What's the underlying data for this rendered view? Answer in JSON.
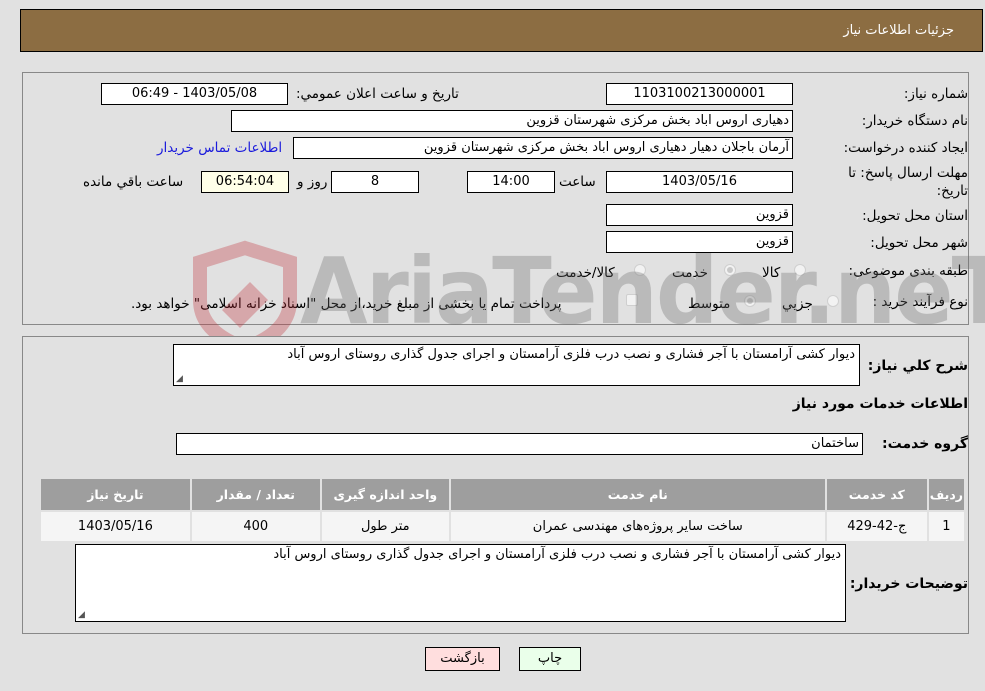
{
  "header": {
    "title": "جزئیات اطلاعات نیاز"
  },
  "fields": {
    "need_number": {
      "label": "شماره نیاز:",
      "value": "1103100213000001"
    },
    "announce_datetime": {
      "label": "تاریخ و ساعت اعلان عمومي:",
      "value": "1403/05/08 - 06:49"
    },
    "buyer_org": {
      "label": "نام دستگاه خریدار:",
      "value": "دهیاری اروس اباد بخش مرکزی شهرستان قزوین"
    },
    "requester": {
      "label": "ایجاد کننده درخواست:",
      "value": "آرمان باجلان دهیار دهیاری اروس اباد بخش مرکزی شهرستان قزوین"
    },
    "buyer_contact_link": "اطلاعات تماس خریدار",
    "deadline": {
      "label_line1": "مهلت ارسال پاسخ: تا",
      "label_line2": "تاریخ:",
      "date": "1403/05/16",
      "time_label": "ساعت",
      "time": "14:00",
      "days": "8",
      "days_label": "روز و",
      "remaining": "06:54:04",
      "remaining_label": "ساعت باقي مانده"
    },
    "delivery_province": {
      "label": "استان محل تحویل:",
      "value": "قزوین"
    },
    "delivery_city": {
      "label": "شهر محل تحویل:",
      "value": "قزوین"
    },
    "category": {
      "label": "طبقه بندی موضوعی:",
      "options": [
        "کالا",
        "خدمت",
        "کالا/خدمت"
      ],
      "selected": "خدمت"
    },
    "purchase_process": {
      "label": "نوع فرآیند خرید :",
      "options": [
        "جزيي",
        "متوسط"
      ],
      "selected": "متوسط",
      "treasury_note": "پرداخت تمام یا بخشی از مبلغ خرید،از محل \"اسناد خزانه اسلامی\" خواهد بود.",
      "treasury_checked": false
    }
  },
  "details": {
    "general_desc_label": "شرح کلي نیاز:",
    "general_desc": "دیوار کشی آرامستان با آجر فشاری و نصب درب فلزی آرامستان و اجرای جدول گذاری روستای اروس آباد",
    "services_heading": "اطلاعات خدمات مورد نیاز",
    "service_group_label": "گروه خدمت:",
    "service_group": "ساختمان",
    "table": {
      "headers": [
        "ردیف",
        "کد خدمت",
        "نام خدمت",
        "واحد اندازه گیری",
        "تعداد / مقدار",
        "تاریخ نیاز"
      ],
      "rows": [
        [
          "1",
          "ج-42-429",
          "ساخت سایر پروژه‌های مهندسی عمران",
          "متر طول",
          "400",
          "1403/05/16"
        ]
      ]
    },
    "buyer_notes_label": "توضیحات خریدار:",
    "buyer_notes": "دیوار کشی آرامستان با آجر فشاری و نصب درب فلزی آرامستان و اجرای جدول گذاری روستای اروس آباد"
  },
  "buttons": {
    "print": "چاپ",
    "back": "بازگشت"
  },
  "watermark": {
    "text": "AriaTender.neT"
  },
  "colors": {
    "header_bg": "#8c6d42",
    "print_bg": "#eaffea",
    "back_bg": "#ffdede",
    "table_header_bg": "#9e9e9e"
  }
}
